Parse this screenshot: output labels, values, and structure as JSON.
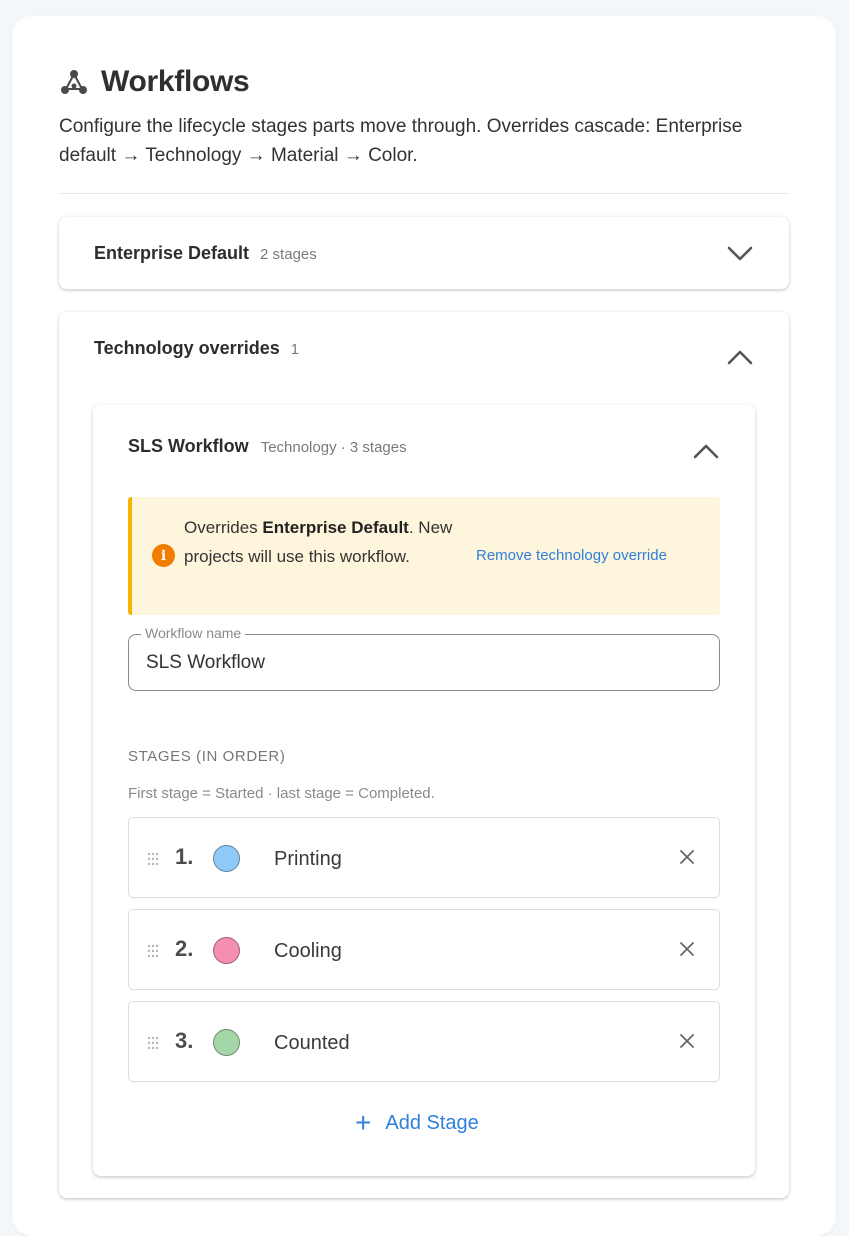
{
  "header": {
    "title": "Workflows",
    "title_icon": "workflow-graph-icon",
    "description": "Configure the lifecycle stages parts move through. Overrides cascade: Enterprise default → Technology → Material → Color."
  },
  "sections": {
    "enterprise": {
      "title": "Enterprise Default",
      "subtitle": "2 stages",
      "expanded": false
    },
    "technology": {
      "title": "Technology overrides",
      "count": "1",
      "expanded": true,
      "workflow": {
        "title": "SLS Workflow",
        "subtitle": "Technology · 3 stages",
        "expanded": true,
        "alert": {
          "prefix": "Overrides ",
          "bold": "Enterprise Default",
          "suffix": ". New projects will use this workflow.",
          "link": "Remove technology override"
        },
        "name_field": {
          "label": "Workflow name",
          "value": "SLS Workflow"
        },
        "stages_title": "STAGES (IN ORDER)",
        "stages_hint": "First stage = Started · last stage = Completed.",
        "stages": [
          {
            "number": "1.",
            "name": "Printing",
            "color": "#90caf9"
          },
          {
            "number": "2.",
            "name": "Cooling",
            "color": "#f48fb1"
          },
          {
            "number": "3.",
            "name": "Counted",
            "color": "#a5d6a7"
          }
        ],
        "add_stage_label": "Add Stage"
      }
    }
  },
  "colors": {
    "accent": "#2f7fdb",
    "warning_border": "#f5b400",
    "warning_bg": "#fdf5dc",
    "info_icon": "#f07c00"
  }
}
